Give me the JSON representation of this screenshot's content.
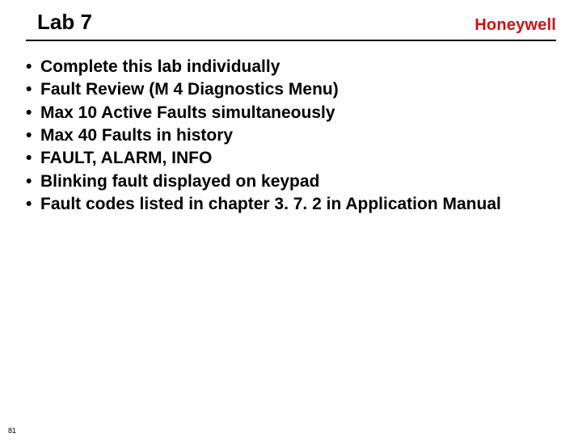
{
  "header": {
    "title": "Lab 7",
    "brand": "Honeywell"
  },
  "bullets": [
    "Complete this lab individually",
    "Fault Review (M 4 Diagnostics Menu)",
    "Max 10 Active Faults simultaneously",
    "Max 40 Faults in history",
    "FAULT, ALARM, INFO",
    "Blinking fault displayed on keypad",
    "Fault codes listed in chapter 3. 7. 2 in Application Manual"
  ],
  "page_number": "81"
}
